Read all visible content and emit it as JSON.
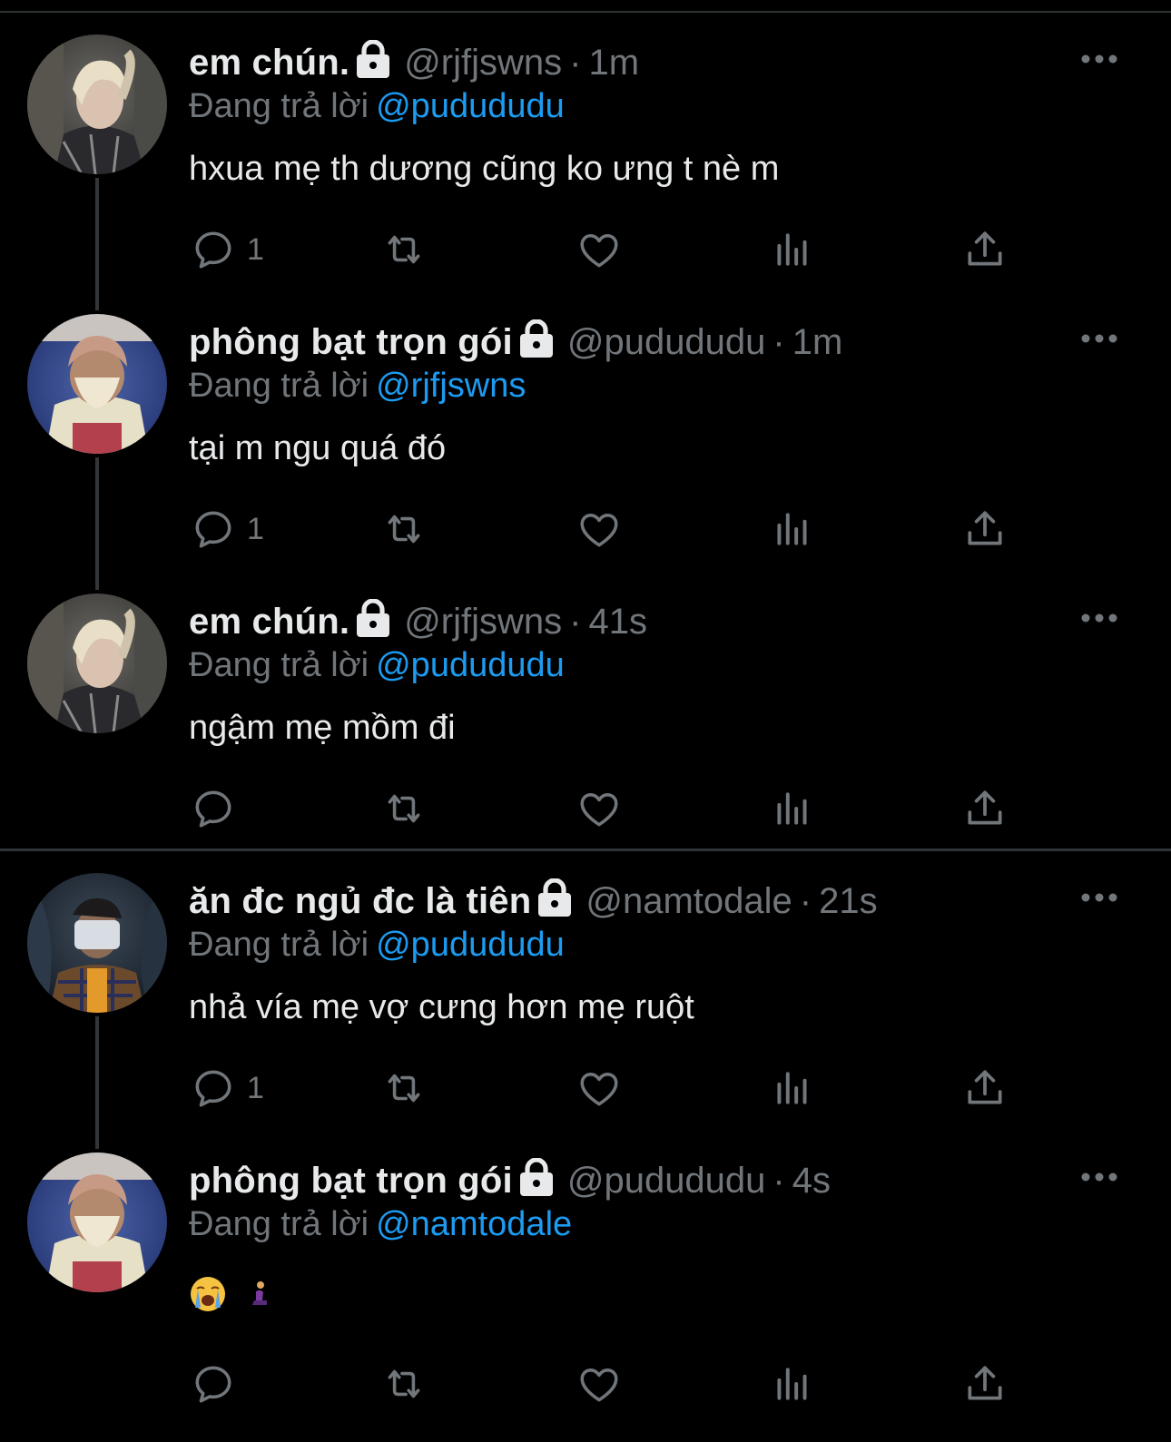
{
  "tweets": [
    {
      "name": "em chún.",
      "handle": "@rjfjswns",
      "separator": "·",
      "time": "1m",
      "reply_prefix": "Đang trả lời",
      "reply_to": "@pudududu",
      "text": "hxua mẹ th dương cũng ko ưng t nè m",
      "reply_count": "1",
      "avatar": "blonde-person-avatar"
    },
    {
      "name": "phông bạt trọn gói",
      "handle": "@pudududu",
      "separator": "·",
      "time": "1m",
      "reply_prefix": "Đang trả lời",
      "reply_to": "@rjfjswns",
      "text": "tại m ngu quá đó",
      "reply_count": "1",
      "avatar": "person-covering-face-avatar"
    },
    {
      "name": "em chún.",
      "handle": "@rjfjswns",
      "separator": "·",
      "time": "41s",
      "reply_prefix": "Đang trả lời",
      "reply_to": "@pudududu",
      "text": "ngậm mẹ mồm đi",
      "reply_count": "",
      "avatar": "blonde-person-avatar"
    },
    {
      "name": "ăn đc ngủ đc là tiên",
      "handle": "@namtodale",
      "separator": "·",
      "time": "21s",
      "reply_prefix": "Đang trả lời",
      "reply_to": "@pudududu",
      "text": "nhả vía mẹ vợ cưng hơn mẹ ruột",
      "reply_count": "1",
      "avatar": "person-with-camera-avatar"
    },
    {
      "name": "phông bạt trọn gói",
      "handle": "@pudududu",
      "separator": "·",
      "time": "4s",
      "reply_prefix": "Đang trả lời",
      "reply_to": "@namtodale",
      "text": "",
      "emojis": [
        "crying-face-emoji",
        "kneeling-person-emoji"
      ],
      "reply_count": "",
      "avatar": "person-covering-face-avatar"
    }
  ],
  "colors": {
    "background": "#000000",
    "text": "#e7e9ea",
    "muted": "#71767b",
    "mention": "#1d9bf0",
    "divider": "#2f3336"
  },
  "icons": [
    "lock-icon",
    "more-icon",
    "reply-icon",
    "retweet-icon",
    "like-icon",
    "views-icon",
    "share-icon"
  ]
}
